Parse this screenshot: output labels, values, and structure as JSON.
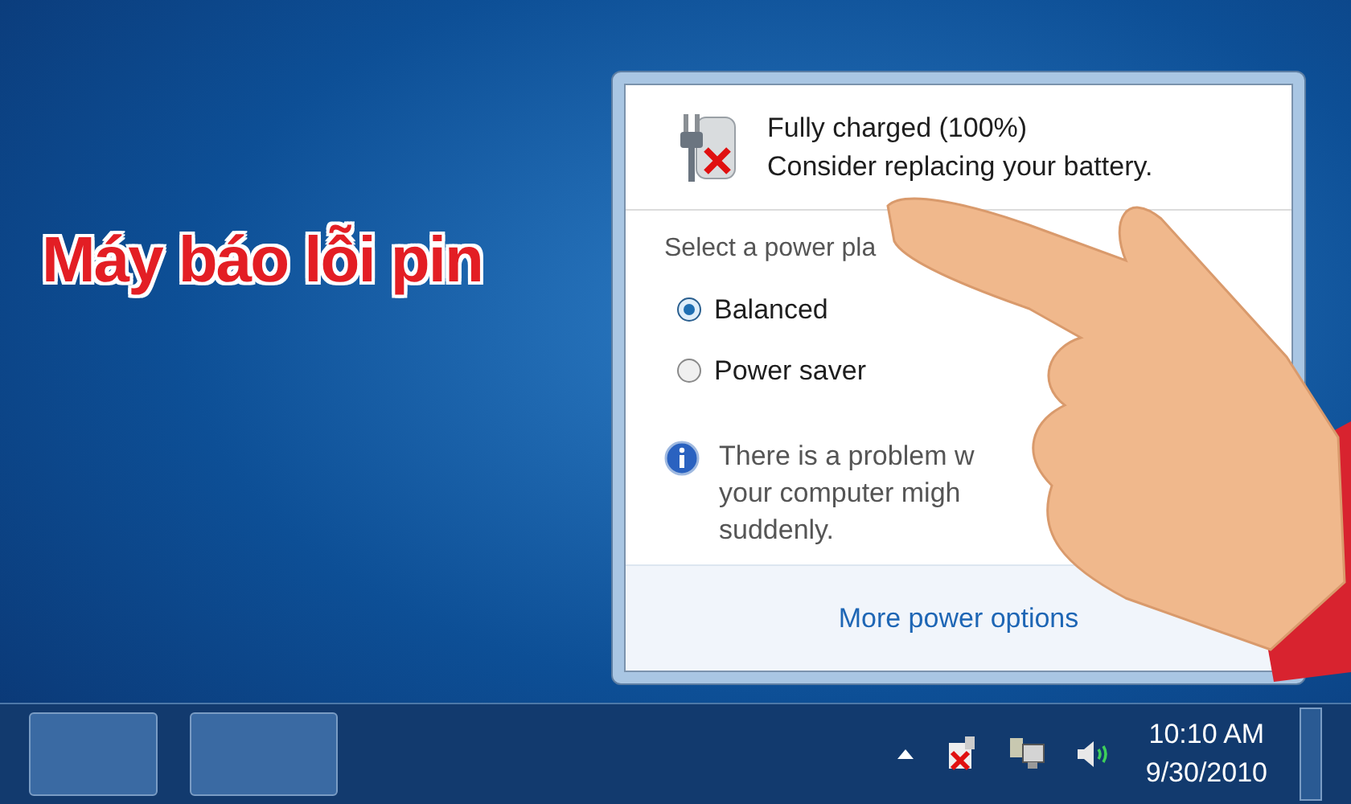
{
  "caption": "Máy báo lỗi pin",
  "popup": {
    "status": "Fully charged (100%)",
    "warning": "Consider replacing your battery.",
    "plan_label": "Select a power pla",
    "plans": [
      {
        "label": "Balanced",
        "selected": true
      },
      {
        "label": "Power saver",
        "selected": false
      }
    ],
    "info_lines": [
      "There is a problem w",
      "your computer migh",
      "suddenly."
    ],
    "link": "More power options"
  },
  "taskbar": {
    "time": "10:10 AM",
    "date": "9/30/2010"
  }
}
